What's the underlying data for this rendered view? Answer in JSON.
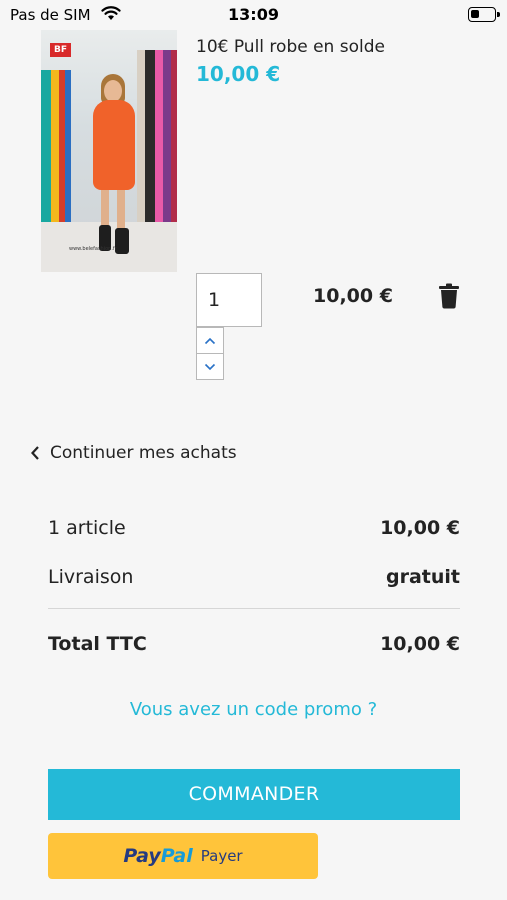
{
  "status_bar": {
    "carrier": "Pas de SIM",
    "time": "13:09",
    "battery_level": 0.4
  },
  "cart_item": {
    "name": "10€ Pull robe en solde",
    "unit_price": "10,00 €",
    "quantity": "1",
    "line_total": "10,00 €",
    "image_logo": "BF",
    "image_watermark": "www.belefashion.fr"
  },
  "navigation": {
    "continue_label": "Continuer mes achats"
  },
  "summary": {
    "items_label": "1 article",
    "items_value": "10,00 €",
    "shipping_label": "Livraison",
    "shipping_value": "gratuit",
    "total_label": "Total TTC",
    "total_value": "10,00 €"
  },
  "promo": {
    "label": "Vous avez un code promo ?"
  },
  "actions": {
    "order_label": "COMMANDER",
    "paypal_brand_pay": "Pay",
    "paypal_brand_pal": "Pal",
    "paypal_label": "Payer"
  },
  "colors": {
    "accent": "#24b9d7",
    "paypal_yellow": "#ffc43a",
    "text": "#232323"
  },
  "icons": [
    "wifi-icon",
    "battery-icon",
    "chevron-up-icon",
    "chevron-down-icon",
    "trash-icon",
    "chevron-left-icon"
  ]
}
